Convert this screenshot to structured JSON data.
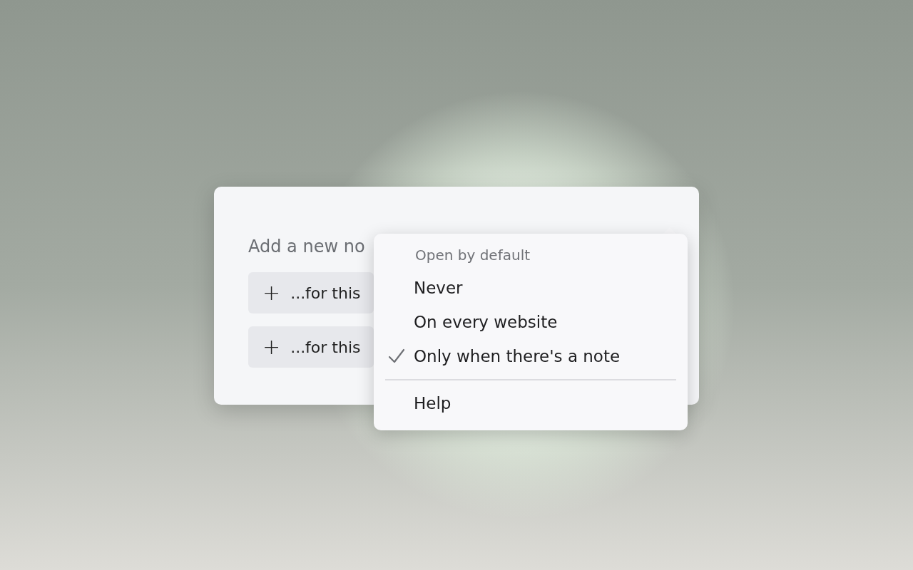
{
  "card": {
    "heading": "Add a new no",
    "buttons": [
      {
        "icon": "+",
        "label": "...for this"
      },
      {
        "icon": "+",
        "label": "...for this"
      }
    ]
  },
  "menu": {
    "header": "Open by default",
    "items": [
      {
        "label": "Never",
        "checked": false
      },
      {
        "label": "On every website",
        "checked": false
      },
      {
        "label": "Only when there's a note",
        "checked": true
      }
    ],
    "footer_item": "Help"
  }
}
